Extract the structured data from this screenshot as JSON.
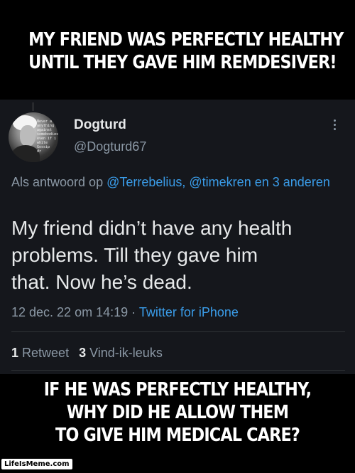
{
  "meme": {
    "top_caption": [
      "MY FRIEND WAS PERFECTLY HEALTHY",
      "UNTIL THEY GAVE HIM REMDESIVER!"
    ],
    "bottom_caption": [
      "IF HE WAS PERFECTLY HEALTHY,",
      "WHY DID HE ALLOW THEM",
      "TO GIVE HIM MEDICAL CARE?"
    ],
    "watermark": "LifeIsMeme.com"
  },
  "tweet": {
    "avatar_text": [
      "Never a",
      "anything",
      "against",
      "somebodies",
      "even if i",
      "white",
      "Gossip",
      "dr"
    ],
    "display_name": "Dogturd",
    "handle": "@Dogturd67",
    "reply_prefix": "Als antwoord op",
    "reply_mentions": "@Terrebelius, @timekren",
    "reply_conj": "en",
    "reply_others": "3 anderen",
    "text_lines": [
      "My friend didn’t have any health",
      "problems.  Till they gave him",
      "that. Now he’s dead."
    ],
    "timestamp": "12 dec. 22 om 14:19",
    "separator": "·",
    "source": "Twitter for iPhone",
    "retweet_count": "1",
    "retweet_label": "Retweet",
    "like_count": "3",
    "like_label": "Vind-ik-leuks"
  },
  "icons": {
    "more": "more-vertical-icon",
    "avatar": "profile-avatar"
  },
  "colors": {
    "background": "#000000",
    "tweet_bg": "#15171c",
    "link": "#3a9ce8",
    "muted": "#8b98a5",
    "text": "#e7e9ea"
  }
}
